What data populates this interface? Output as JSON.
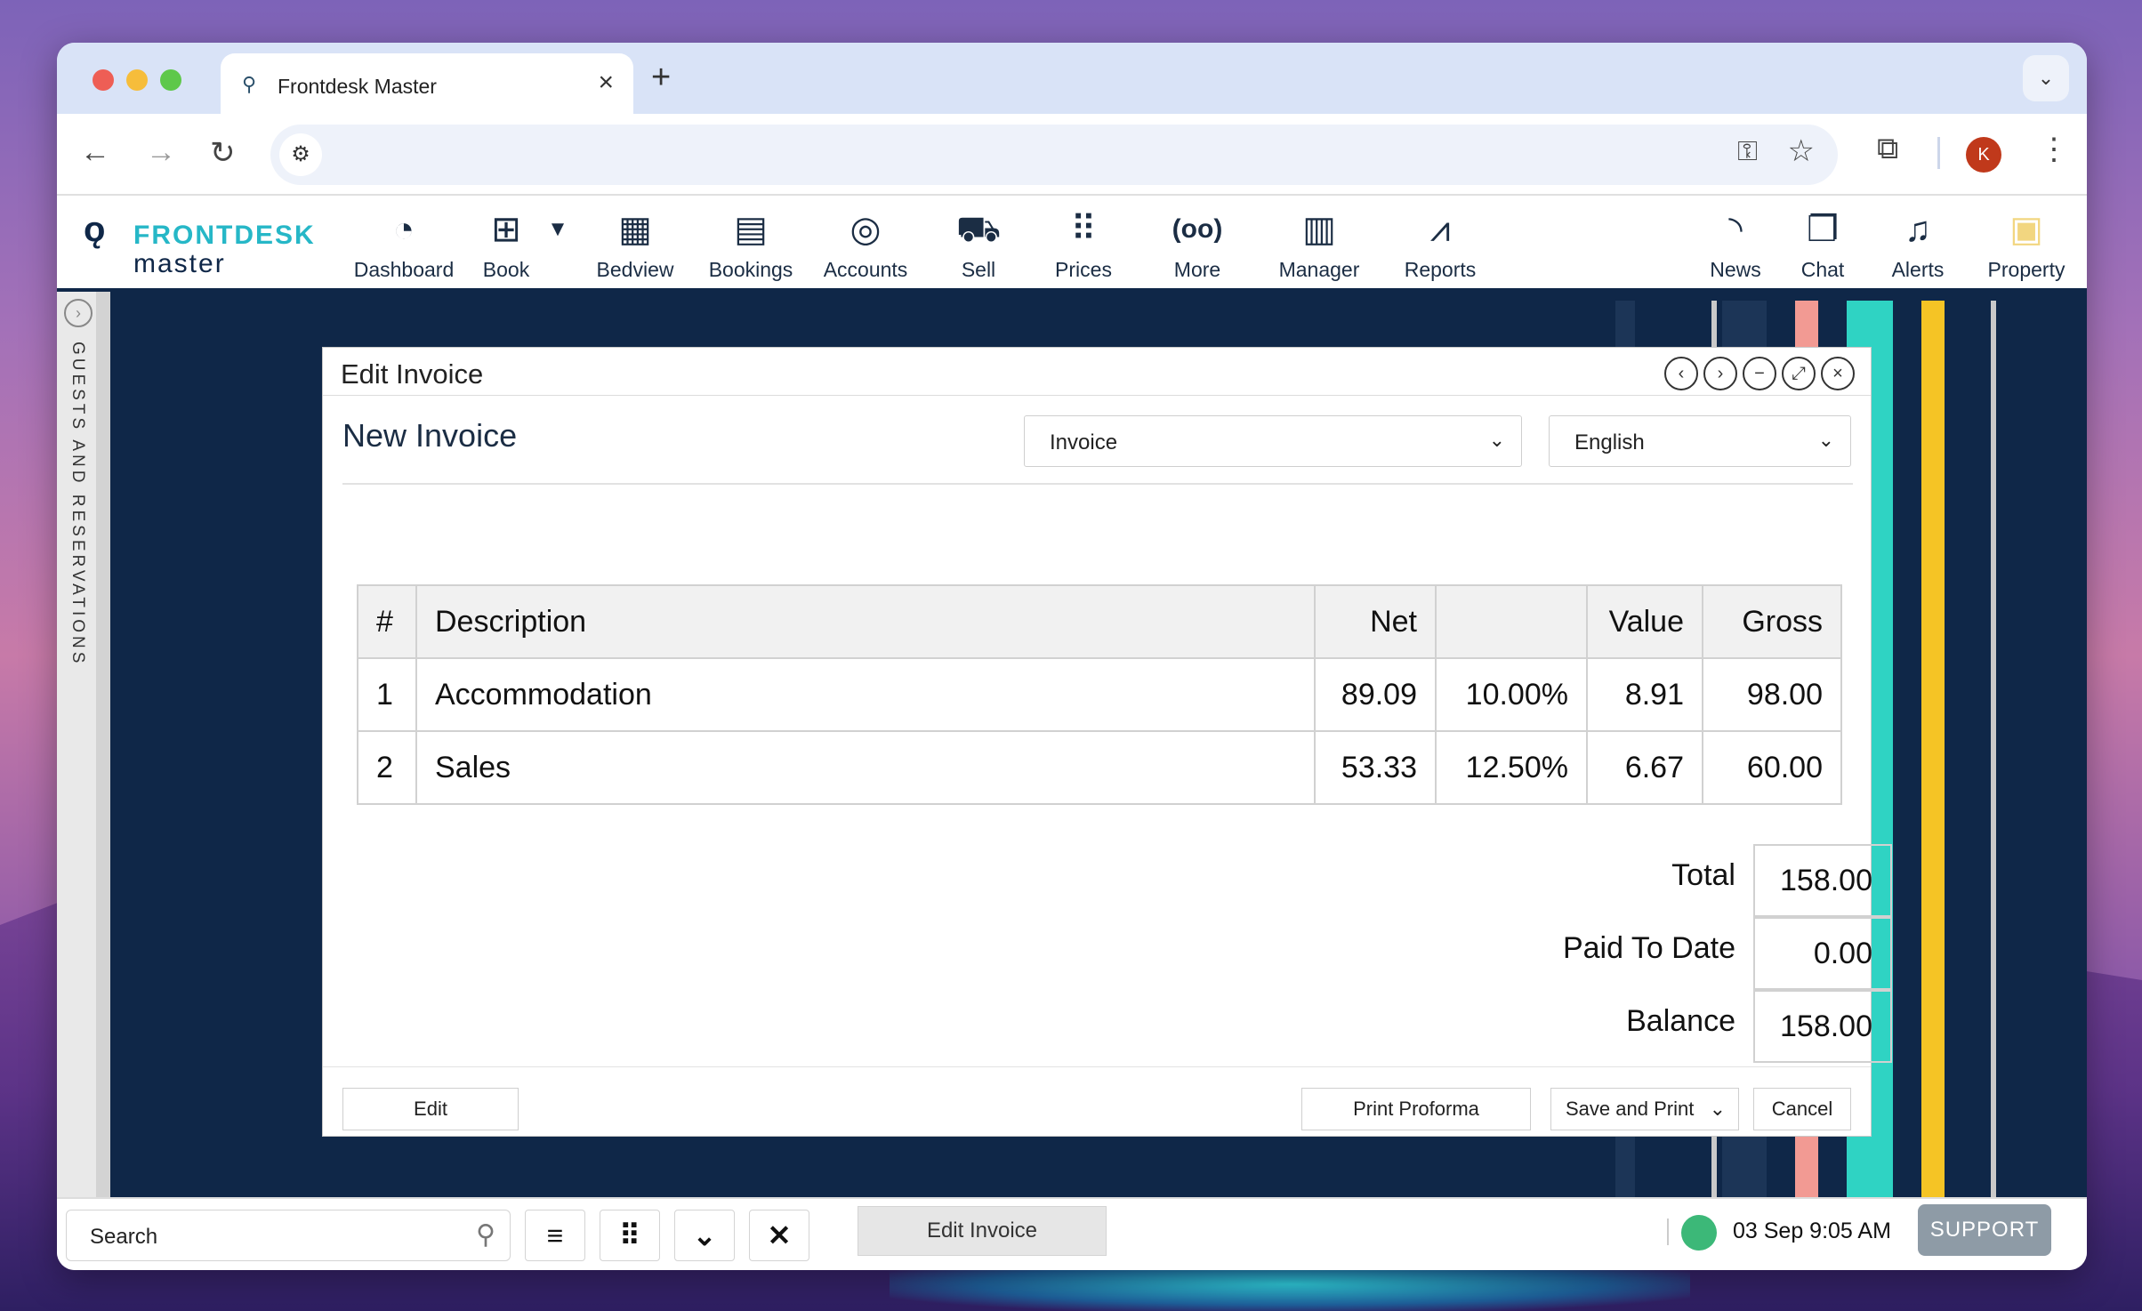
{
  "browser": {
    "tab_title": "Frontdesk Master",
    "new_tab": "+",
    "close": "×",
    "profile_initial": "K"
  },
  "logo": {
    "top": "FRONTDESK",
    "bottom": "master"
  },
  "nav": {
    "left": [
      {
        "label": "Dashboard",
        "icon": "dashboard-gauge-icon",
        "glyph": "◔"
      },
      {
        "label": "Book",
        "icon": "book-plus-icon",
        "glyph": "⊞"
      },
      {
        "label": "Bedview",
        "icon": "grid-icon",
        "glyph": "▦"
      },
      {
        "label": "Bookings",
        "icon": "open-book-icon",
        "glyph": "📖"
      },
      {
        "label": "Accounts",
        "icon": "money-search-icon",
        "glyph": "◎"
      },
      {
        "label": "Sell",
        "icon": "cart-icon",
        "glyph": "🛒"
      },
      {
        "label": "Prices",
        "icon": "dots-grid-icon",
        "glyph": "⠿"
      },
      {
        "label": "More",
        "icon": "more-icon",
        "glyph": "(oo)"
      },
      {
        "label": "Manager",
        "icon": "building-icon",
        "glyph": "▥"
      },
      {
        "label": "Reports",
        "icon": "chart-icon",
        "glyph": "📈"
      }
    ],
    "right": [
      {
        "label": "News",
        "icon": "rss-icon",
        "glyph": "◠"
      },
      {
        "label": "Chat",
        "icon": "chat-icon",
        "glyph": "💬"
      },
      {
        "label": "Alerts",
        "icon": "bell-icon",
        "glyph": "🔔"
      },
      {
        "label": "Property",
        "icon": "property-icon",
        "glyph": "▣"
      }
    ]
  },
  "sidebar": {
    "label": "GUESTS AND RESERVATIONS"
  },
  "modal": {
    "title": "Edit Invoice",
    "invoice_title": "New Invoice",
    "type_select": "Invoice",
    "language_select": "English",
    "columns": [
      "#",
      "Description",
      "Net",
      "",
      "Value",
      "Gross"
    ],
    "rows": [
      {
        "n": "1",
        "description": "Accommodation",
        "net": "89.09",
        "rate": "10.00%",
        "value": "8.91",
        "gross": "98.00"
      },
      {
        "n": "2",
        "description": "Sales",
        "net": "53.33",
        "rate": "12.50%",
        "value": "6.67",
        "gross": "60.00"
      }
    ],
    "totals": [
      {
        "label": "Total",
        "value": "158.00"
      },
      {
        "label": "Paid To Date",
        "value": "0.00"
      },
      {
        "label": "Balance",
        "value": "158.00"
      }
    ],
    "buttons": {
      "edit": "Edit",
      "print_proforma": "Print Proforma",
      "save_and_print": "Save and Print",
      "cancel": "Cancel"
    }
  },
  "bottombar": {
    "search_placeholder": "Search",
    "open_tab": "Edit Invoice",
    "datetime": "03 Sep 9:05 AM",
    "support": "SUPPORT"
  },
  "colors": {
    "navy": "#0f2748",
    "teal_stripe": "#2fd3c3",
    "yellow_stripe": "#f5c425",
    "pink_stripe": "#f29a93",
    "status_green": "#3cb878"
  }
}
